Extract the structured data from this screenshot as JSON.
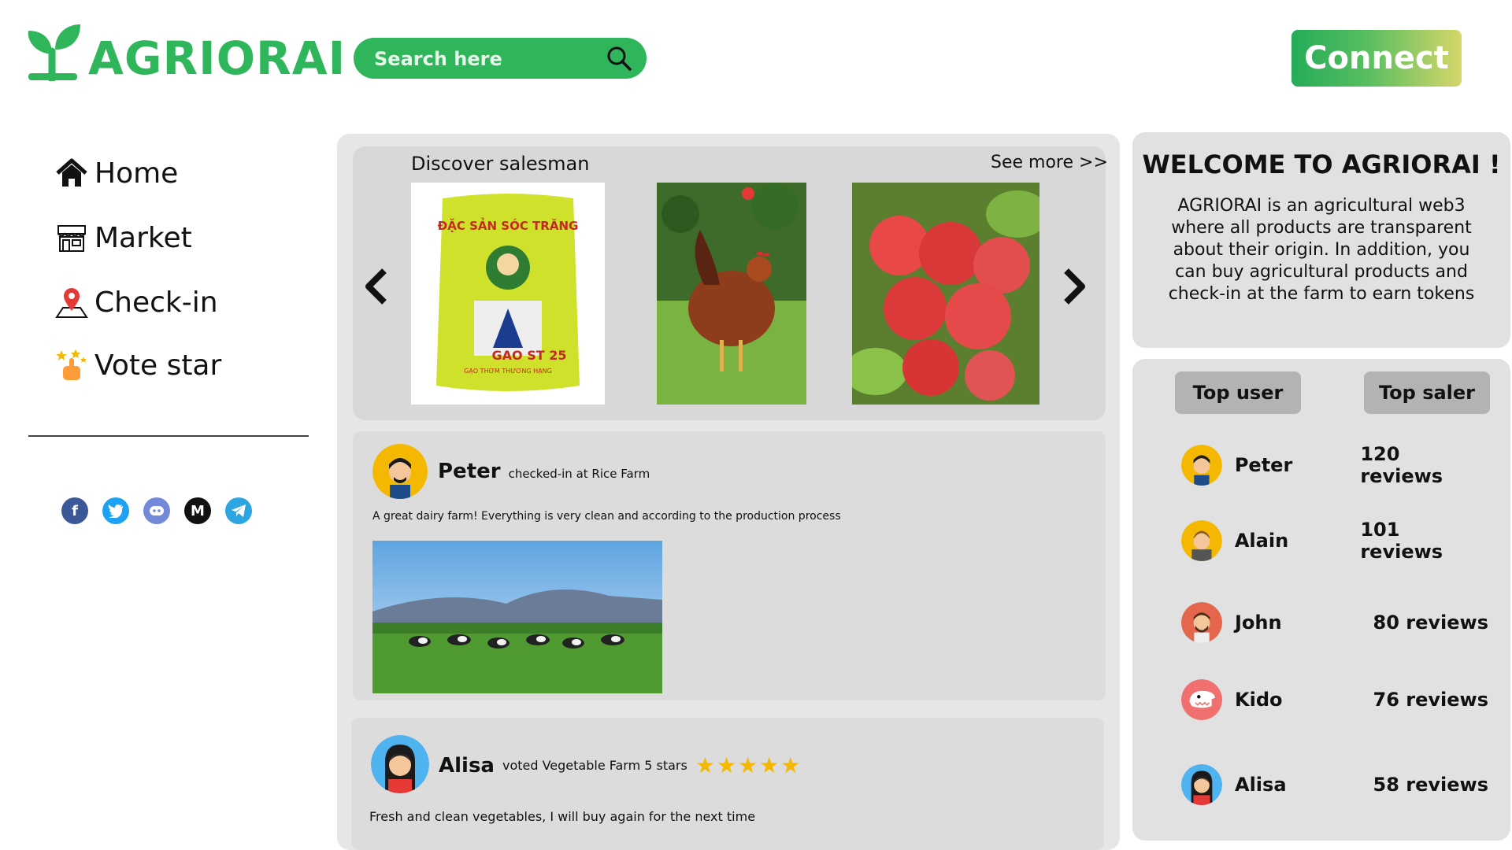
{
  "header": {
    "logo_text": "AGRIORAI",
    "search_placeholder": "Search here",
    "connect_label": "Connect"
  },
  "sidebar": {
    "items": [
      {
        "label": "Home",
        "icon": "home-icon"
      },
      {
        "label": "Market",
        "icon": "market-icon"
      },
      {
        "label": "Check-in",
        "icon": "map-pin-icon"
      },
      {
        "label": "Vote star",
        "icon": "star-hand-icon"
      }
    ],
    "social": [
      "facebook-icon",
      "twitter-icon",
      "discord-icon",
      "medium-icon",
      "telegram-icon"
    ]
  },
  "discover": {
    "title": "Discover salesman",
    "see_more": "See more >>",
    "products": [
      {
        "name": "rice-bag",
        "text_lines": [
          "ĐẶC SẢN SÓC TRĂNG",
          "GAO ST 25",
          "GẠO THƠM THƯƠNG HẠNG"
        ]
      },
      {
        "name": "rooster"
      },
      {
        "name": "apples"
      }
    ]
  },
  "feed": {
    "posts": [
      {
        "name": "Peter",
        "action": "checked-in at Rice Farm",
        "text": "A great dairy farm! Everything is very clean and according to the production process"
      },
      {
        "name": "Alisa",
        "action": "voted Vegetable Farm 5 stars",
        "stars": 5,
        "text": "Fresh and clean vegetables, I will buy again for the next time"
      }
    ]
  },
  "welcome": {
    "title": "WELCOME TO AGRIORAI !",
    "body": "AGRIORAI is an agricultural web3 where all products are transparent about their origin. In addition, you can buy agricultural products and check-in at the farm to earn tokens"
  },
  "ranking": {
    "tabs": [
      "Top user",
      "Top saler"
    ],
    "rows": [
      {
        "name": "Peter",
        "reviews": "120 reviews"
      },
      {
        "name": "Alain",
        "reviews": "101 reviews"
      },
      {
        "name": "John",
        "reviews": "80 reviews"
      },
      {
        "name": "Kido",
        "reviews": "76 reviews"
      },
      {
        "name": "Alisa",
        "reviews": "58 reviews"
      }
    ]
  },
  "colors": {
    "brand_green": "#2fb55a",
    "panel_gray": "#e6e6e6",
    "tab_gray": "#b3b3b3",
    "star_gold": "#f5b800"
  }
}
